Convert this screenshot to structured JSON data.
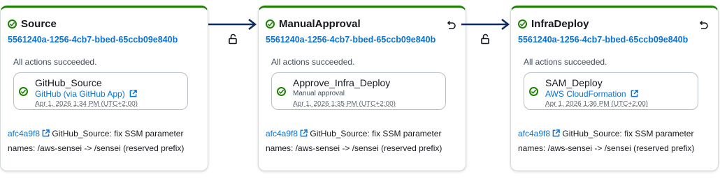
{
  "stages": [
    {
      "title": "Source",
      "execution_id": "5561240a-1256-4cb7-bbed-65ccb09e840b",
      "status": "All actions succeeded.",
      "action": {
        "name": "GitHub_Source",
        "provider": "GitHub (via GitHub App)",
        "time": "Apr 1, 2026 1:34 PM (UTC+2:00)"
      },
      "commit": {
        "id": "afc4a9f8",
        "message": "GitHub_Source: fix SSM parameter names: /aws-sensei -> /sensei (reserved prefix)"
      }
    },
    {
      "title": "ManualApproval",
      "execution_id": "5561240a-1256-4cb7-bbed-65ccb09e840b",
      "status": "All actions succeeded.",
      "action": {
        "name": "Approve_Infra_Deploy",
        "provider": "Manual approval",
        "time": "Apr 1, 2026 1:35 PM (UTC+2:00)"
      },
      "commit": {
        "id": "afc4a9f8",
        "message": "GitHub_Source: fix SSM parameter names: /aws-sensei -> /sensei (reserved prefix)"
      }
    },
    {
      "title": "InfraDeploy",
      "execution_id": "5561240a-1256-4cb7-bbed-65ccb09e840b",
      "status": "All actions succeeded.",
      "action": {
        "name": "SAM_Deploy",
        "provider": "AWS CloudFormation",
        "time": "Apr 1, 2026 1:36 PM (UTC+2:00)"
      },
      "commit": {
        "id": "afc4a9f8",
        "message": "GitHub_Source: fix SSM parameter names: /aws-sensei -> /sensei (reserved prefix)"
      }
    }
  ],
  "icons": {
    "success": "check-circle-icon",
    "retry": "undo-icon",
    "transition": "unlock-icon",
    "external": "external-link-icon"
  },
  "colors": {
    "success": "#1d8102",
    "link": "#0972d3",
    "arrow": "#0f2a5c"
  }
}
